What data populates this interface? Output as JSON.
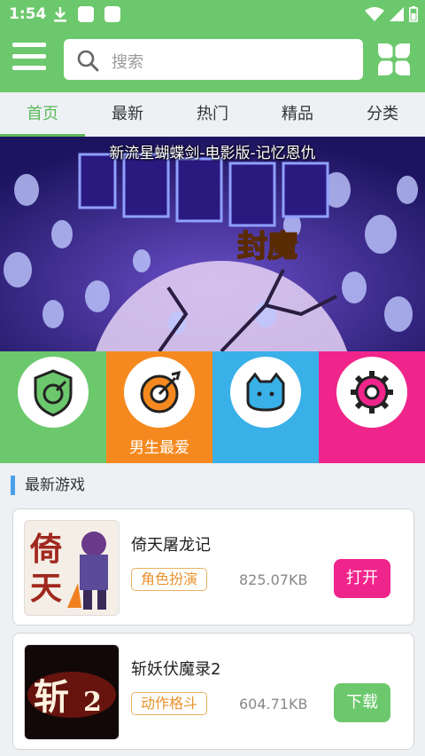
{
  "status_bar": {
    "time": "1:54"
  },
  "search": {
    "placeholder": "搜索"
  },
  "tabs": [
    {
      "label": "首页",
      "active": true
    },
    {
      "label": "最新"
    },
    {
      "label": "热门"
    },
    {
      "label": "精品"
    },
    {
      "label": "分类"
    }
  ],
  "banner": {
    "title": "新流星蝴蝶剑-电影版-记忆恩仇"
  },
  "categories": [
    {
      "label": "",
      "color": "#6cc86c",
      "icon": "shield-icon"
    },
    {
      "label": "男生最爱",
      "color": "#f5891f",
      "icon": "target-icon"
    },
    {
      "label": "",
      "color": "#3ab0e8",
      "icon": "cat-icon"
    },
    {
      "label": "",
      "color": "#f0258c",
      "icon": "gear-icon"
    }
  ],
  "section": {
    "title": "最新游戏"
  },
  "games": [
    {
      "name": "倚天屠龙记",
      "tag": "角色扮演",
      "size": "825.07KB",
      "button": "打开",
      "button_color": "#f0258c"
    },
    {
      "name": "斩妖伏魔录2",
      "tag": "动作格斗",
      "size": "604.71KB",
      "button": "下载",
      "button_color": "#6cc86c"
    }
  ],
  "colors": {
    "header": "#6cc86c",
    "accent": "#5cb85c"
  }
}
